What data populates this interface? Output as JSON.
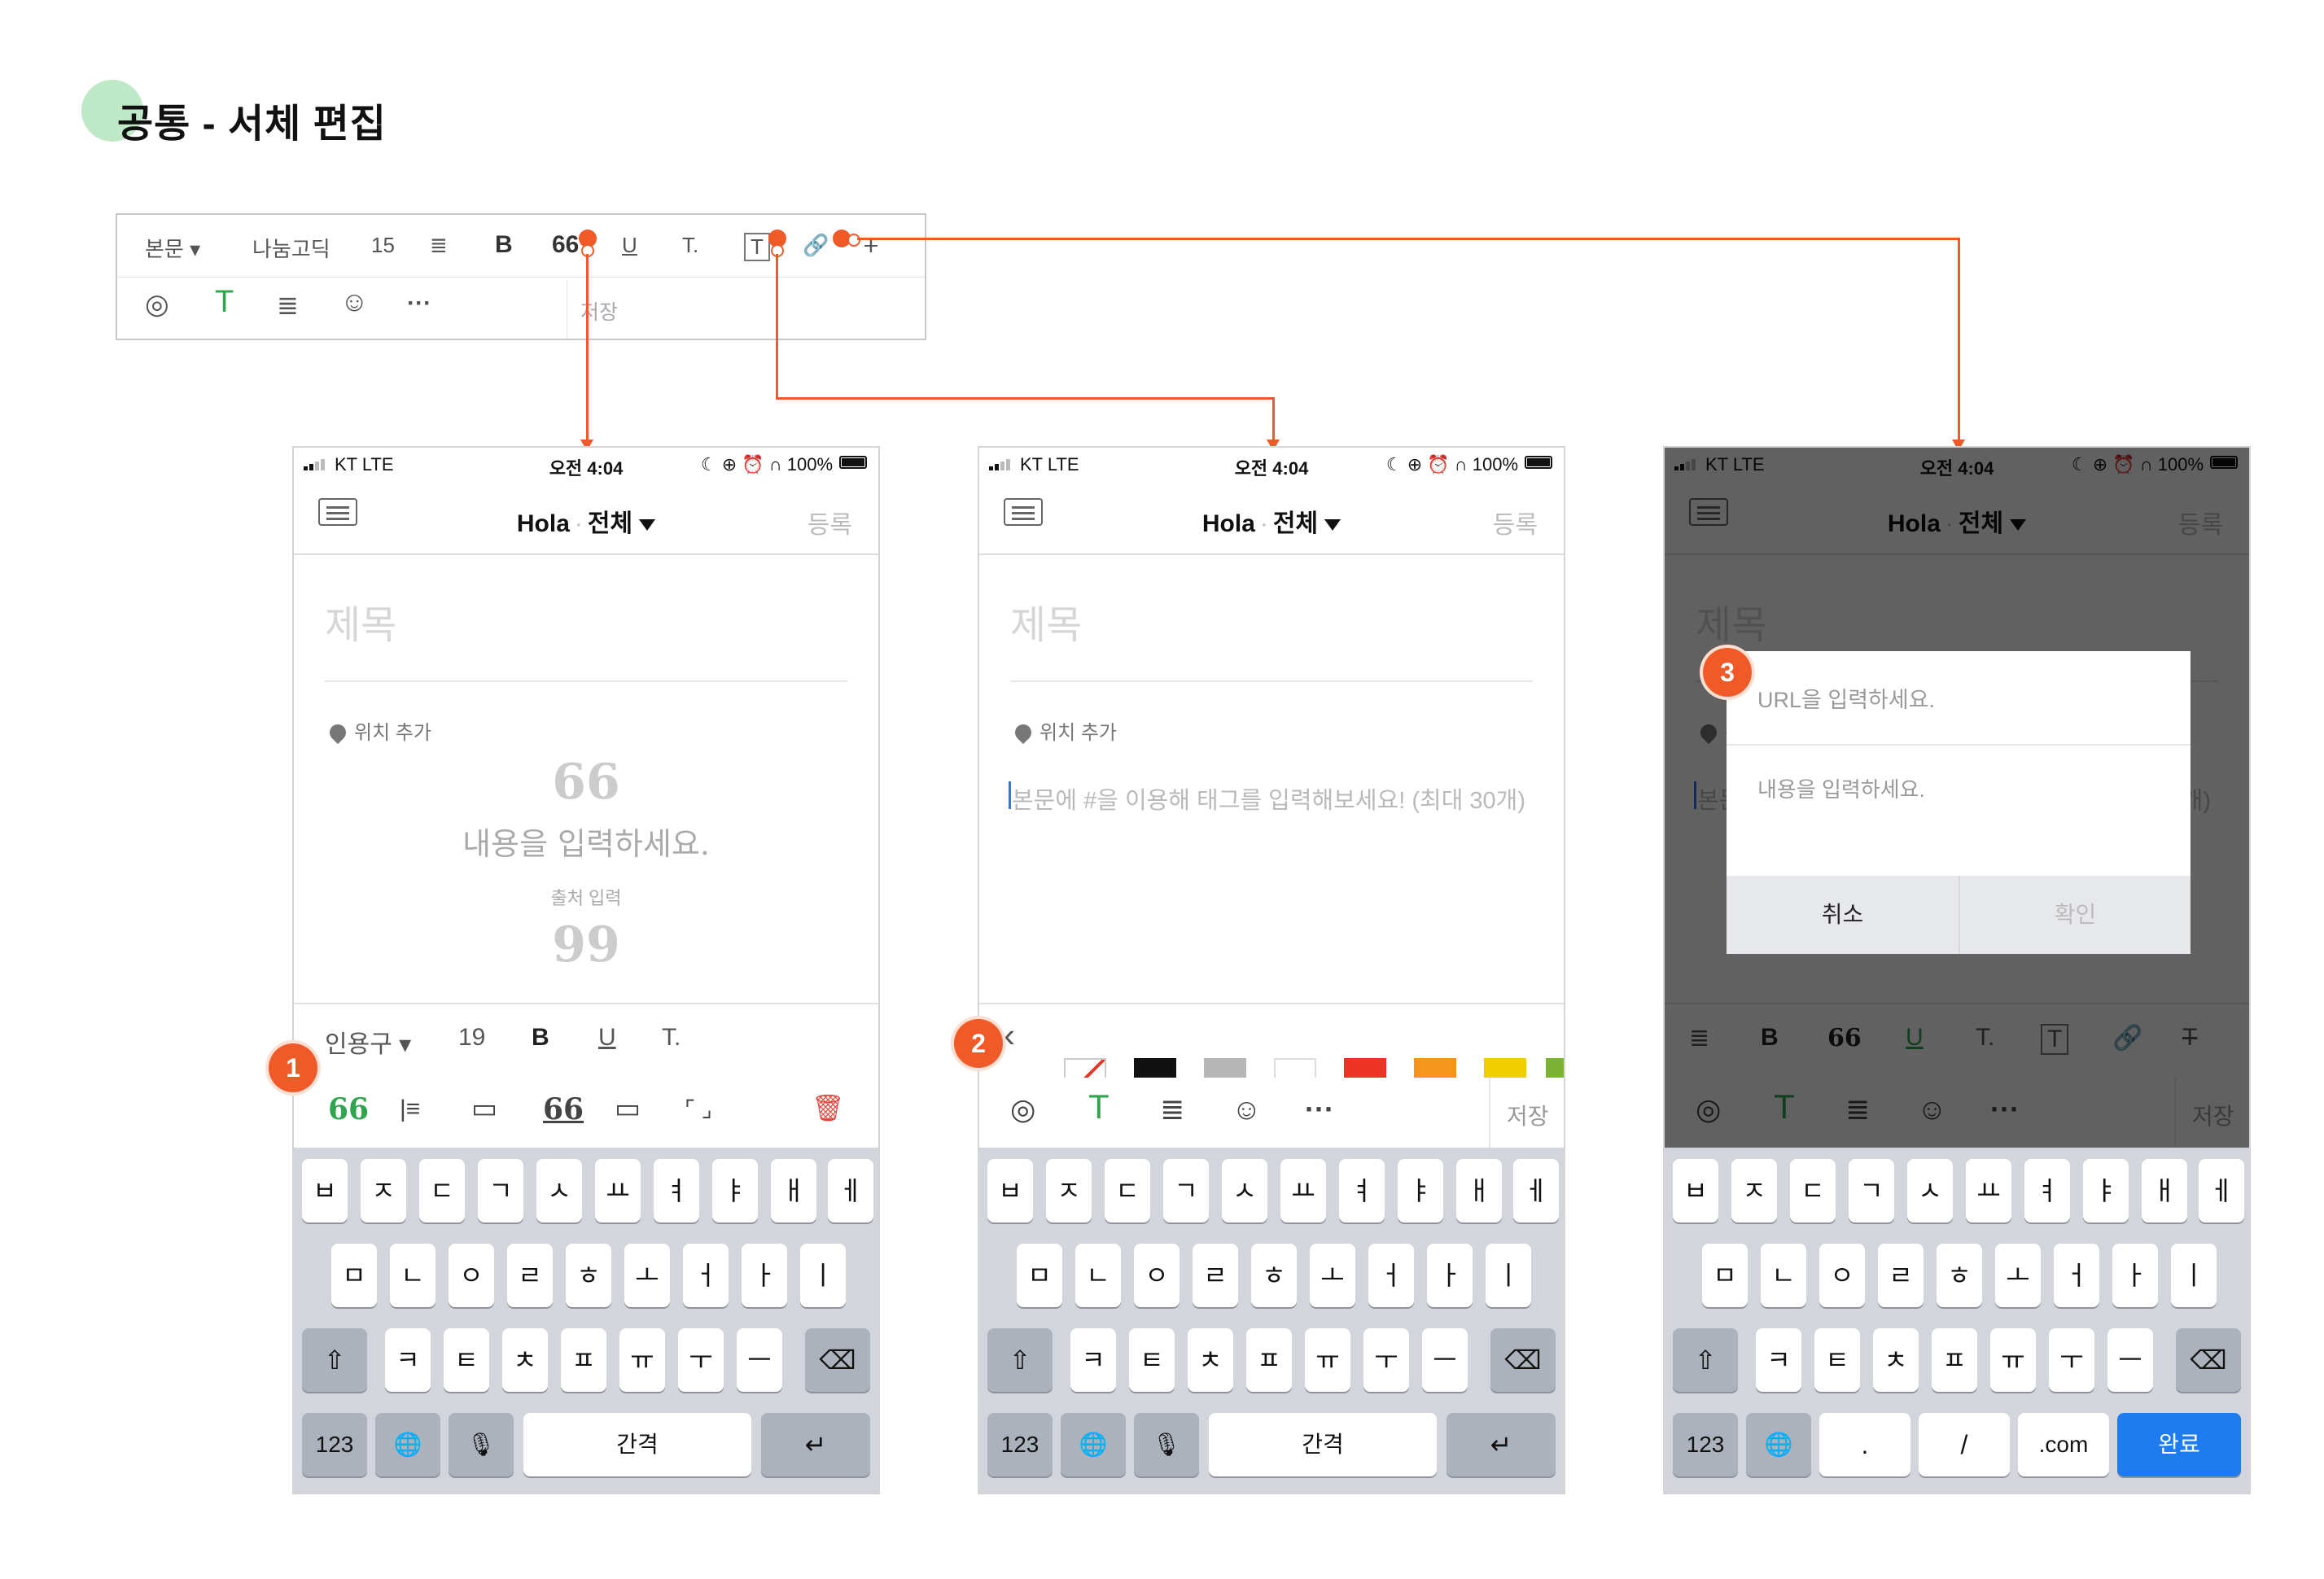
{
  "page": {
    "title": "공통 - 서체 편집"
  },
  "toolbar": {
    "row1": [
      "본문 ▾",
      "나눔고딕",
      "15",
      "≣",
      "B",
      "66",
      "U",
      "T.",
      "T",
      "🔗",
      "T"
    ],
    "row2": [
      "◎",
      "T",
      "≣",
      "☺",
      "···"
    ],
    "save_label": "저장"
  },
  "status": {
    "carrier": "KT  LTE",
    "time": "오전 4:04",
    "right": "☾ ⊕ ⏰ ∩ 100%"
  },
  "nav": {
    "brand": "Hola",
    "sep": "·",
    "filter": "전체",
    "register": "등록"
  },
  "editor": {
    "title_placeholder": "제목",
    "location": "위치 추가",
    "quote_open": "66",
    "quote_text": "내용을 입력하세요.",
    "quote_source": "출처 입력",
    "quote_close": "99",
    "body_placeholder": "본문에 #을 이용해 태그를 입력해보세요! (최대 30개)"
  },
  "quote_toolbar": {
    "style": "인용구 ▾",
    "size": "19",
    "bold": "B",
    "underline": "U",
    "text": "T.",
    "styles": [
      "66",
      "|≡",
      "▭",
      "66",
      "▭",
      "⌜ ⌟",
      "🗑"
    ]
  },
  "color_toolbar": {
    "back": "‹",
    "colors": [
      "none",
      "#111111",
      "#b7b7b7",
      "#ffffff",
      "#ee3424",
      "#f7941d",
      "#f0cf00",
      "#7cb332"
    ]
  },
  "bottom_tools": [
    "◎",
    "T",
    "≣",
    "☺",
    "···"
  ],
  "bottom_save": "저장",
  "dim_toolbar": [
    "≣",
    "B",
    "66",
    "U",
    "T.",
    "T",
    "🔗",
    "T"
  ],
  "keyboard": {
    "row1": [
      "ㅂ",
      "ㅈ",
      "ㄷ",
      "ㄱ",
      "ㅅ",
      "ㅛ",
      "ㅕ",
      "ㅑ",
      "ㅐ",
      "ㅔ"
    ],
    "row2": [
      "ㅁ",
      "ㄴ",
      "ㅇ",
      "ㄹ",
      "ㅎ",
      "ㅗ",
      "ㅓ",
      "ㅏ",
      "ㅣ"
    ],
    "row3": [
      "ㅋ",
      "ㅌ",
      "ㅊ",
      "ㅍ",
      "ㅠ",
      "ㅜ",
      "ㅡ"
    ],
    "shift": "⇧",
    "delete": "⌫",
    "num": "123",
    "globe": "🌐",
    "mic": "🎙",
    "space": "간격",
    "return": "↵",
    "url_keys": [
      ".",
      "/",
      ".com"
    ],
    "done": "완료"
  },
  "dialog": {
    "url_placeholder": "URL을 입력하세요.",
    "content_placeholder": "내용을 입력하세요.",
    "cancel": "취소",
    "confirm": "확인"
  },
  "badges": [
    "1",
    "2",
    "3"
  ],
  "accent": "#f05a28"
}
